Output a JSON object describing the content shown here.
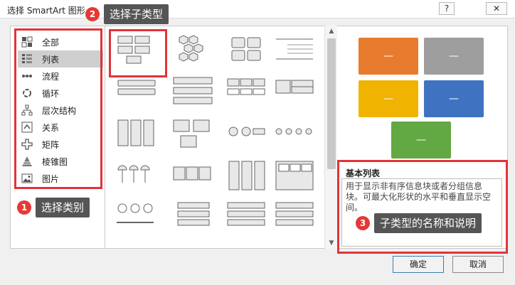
{
  "dialog": {
    "title": "选择 SmartArt 图形",
    "help_label": "?",
    "close_label": "✕",
    "ok_label": "确定",
    "cancel_label": "取消"
  },
  "callouts": [
    {
      "num": "1",
      "text": "选择类别"
    },
    {
      "num": "2",
      "text": "选择子类型"
    },
    {
      "num": "3",
      "text": "子类型的名称和说明"
    }
  ],
  "categories": [
    {
      "label": "全部",
      "icon": "all-icon"
    },
    {
      "label": "列表",
      "icon": "list-icon",
      "selected": true
    },
    {
      "label": "流程",
      "icon": "process-icon"
    },
    {
      "label": "循环",
      "icon": "cycle-icon"
    },
    {
      "label": "层次结构",
      "icon": "hierarchy-icon"
    },
    {
      "label": "关系",
      "icon": "relationship-icon"
    },
    {
      "label": "矩阵",
      "icon": "matrix-icon"
    },
    {
      "label": "棱锥图",
      "icon": "pyramid-icon"
    },
    {
      "label": "图片",
      "icon": "picture-icon"
    }
  ],
  "preview": {
    "box_label": "—",
    "colors": [
      "#e97b2f",
      "#9e9e9e",
      "#f0b400",
      "#3f73c1",
      "#62a843"
    ]
  },
  "description": {
    "title": "基本列表",
    "text": "用于显示非有序信息块或者分组信息块。可最大化形状的水平和垂直显示空间。"
  },
  "colors": {
    "callout_red": "#e53935",
    "callout_bg": "#555555",
    "frame_red": "#e0343a"
  }
}
